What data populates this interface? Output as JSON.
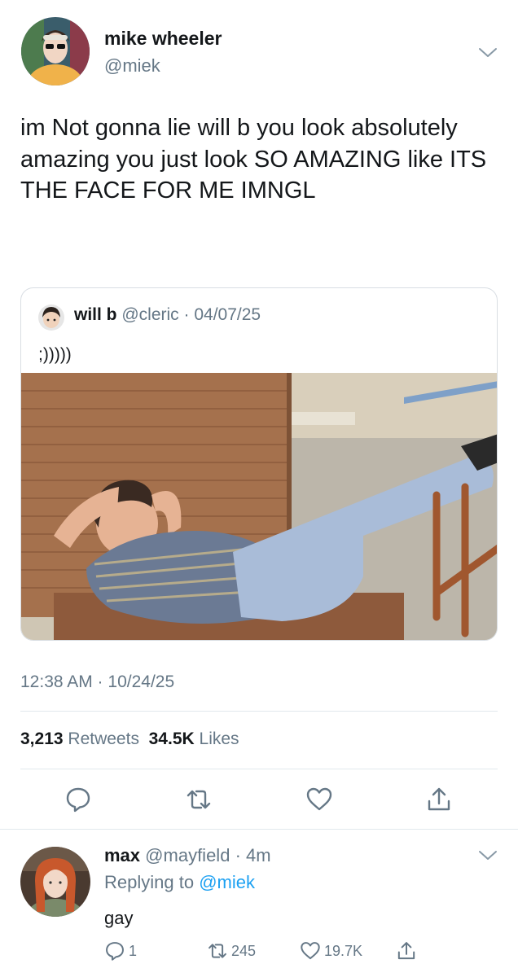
{
  "tweet": {
    "author_name": "mike wheeler",
    "author_handle": "@miek",
    "text": "im Not gonna lie will b you look absolutely amazing you just look SO AMAZING like ITS THE FACE FOR ME IMNGL",
    "timestamp": "12:38 AM · 10/24/25",
    "retweets_count": "3,213",
    "retweets_label": "Retweets",
    "likes_count": "34.5K",
    "likes_label": "Likes",
    "menu_icon": "chevron-down-icon",
    "actions": [
      "reply-icon",
      "retweet-icon",
      "like-icon",
      "share-icon"
    ]
  },
  "quoted": {
    "author_name": "will b",
    "author_handle": "@cleric",
    "date": "· 04/07/25",
    "text": ";)))))",
    "photo_alt": "photo"
  },
  "reply": {
    "author_name": "max",
    "author_handle": "@mayfield",
    "time": "· 4m",
    "replying_prefix": "Replying to",
    "replying_handle": "@miek",
    "text": "gay",
    "reply_count": "1",
    "retweet_count": "245",
    "like_count": "19.7K"
  },
  "colors": {
    "text_primary": "#14171a",
    "text_secondary": "#657786",
    "accent": "#1da1f2",
    "divider": "#e1e8ed"
  }
}
